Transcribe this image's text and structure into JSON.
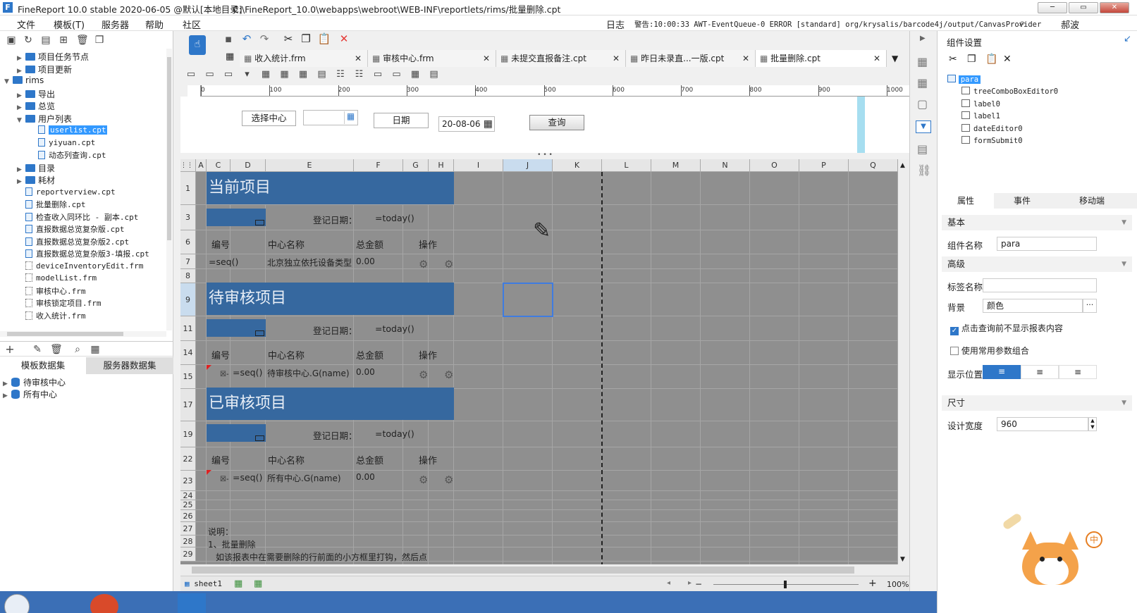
{
  "window": {
    "title": "FineReport 10.0 stable 2020-06-05 @默认[本地目录]",
    "path": "C:\\FineReport_10.0\\webapps\\webroot\\WEB-INF\\reportlets/rims/批量删除.cpt",
    "btn_min": "─",
    "btn_max": "▭",
    "btn_close": "✕"
  },
  "menu": [
    "文件",
    "模板(T)",
    "服务器",
    "帮助",
    "社区"
  ],
  "status": {
    "log": "日志",
    "warning": "警告:10:00:33 AWT-EventQueue-0 ERROR [standard] org/krysalis/barcode4j/output/CanvasProvider",
    "user": "郝波"
  },
  "tree": [
    {
      "label": "项目任务节点",
      "type": "folder",
      "indent": 1,
      "arrow": "▶"
    },
    {
      "label": "项目更新",
      "type": "folder",
      "indent": 1,
      "arrow": "▶"
    },
    {
      "label": "rims",
      "type": "folder",
      "indent": 0,
      "arrow": "▼"
    },
    {
      "label": "导出",
      "type": "folder",
      "indent": 1,
      "arrow": "▶"
    },
    {
      "label": "总览",
      "type": "folder",
      "indent": 1,
      "arrow": "▶"
    },
    {
      "label": "用户列表",
      "type": "folder",
      "indent": 1,
      "arrow": "▼"
    },
    {
      "label": "userlist.cpt",
      "type": "cpt",
      "indent": 2,
      "selected": true
    },
    {
      "label": "yiyuan.cpt",
      "type": "cpt",
      "indent": 2
    },
    {
      "label": "动态列查询.cpt",
      "type": "cpt",
      "indent": 2
    },
    {
      "label": "目录",
      "type": "folder",
      "indent": 1,
      "arrow": "▶"
    },
    {
      "label": "耗材",
      "type": "folder",
      "indent": 1,
      "arrow": "▶"
    },
    {
      "label": "reportverview.cpt",
      "type": "cpt",
      "indent": 1
    },
    {
      "label": "批量删除.cpt",
      "type": "cpt",
      "indent": 1
    },
    {
      "label": "检查收入同环比 - 副本.cpt",
      "type": "cpt",
      "indent": 1
    },
    {
      "label": "直报数据总览复杂版.cpt",
      "type": "cpt",
      "indent": 1
    },
    {
      "label": "直报数据总览复杂版2.cpt",
      "type": "cpt",
      "indent": 1
    },
    {
      "label": "直报数据总览复杂版3-填报.cpt",
      "type": "cpt",
      "indent": 1
    },
    {
      "label": "deviceInventoryEdit.frm",
      "type": "frm",
      "indent": 1
    },
    {
      "label": "modelList.frm",
      "type": "frm",
      "indent": 1
    },
    {
      "label": "审核中心.frm",
      "type": "frm",
      "indent": 1
    },
    {
      "label": "审核锁定项目.frm",
      "type": "frm",
      "indent": 1
    },
    {
      "label": "收入统计.frm",
      "type": "frm",
      "indent": 1
    }
  ],
  "dataset_tabs": [
    "模板数据集",
    "服务器数据集"
  ],
  "datasets": [
    "待审核中心",
    "所有中心"
  ],
  "tabs": [
    "收入统计.frm",
    "审核中心.frm",
    "未提交直报备注.cpt",
    "昨日未录直...一版.cpt",
    "批量删除.cpt"
  ],
  "ruler": [
    "0",
    "100",
    "200",
    "300",
    "400",
    "500",
    "600",
    "700",
    "800",
    "900",
    "1000"
  ],
  "params": {
    "center_label": "选择中心",
    "date_label": "日期",
    "date_value": "20-08-06",
    "query_btn": "查询"
  },
  "columns": [
    "A",
    "C",
    "D",
    "E",
    "F",
    "G",
    "H",
    "I",
    "J",
    "K",
    "L",
    "M",
    "N",
    "O",
    "P",
    "Q"
  ],
  "rows": [
    "1",
    "3",
    "6",
    "7",
    "8",
    "9",
    "11",
    "14",
    "15",
    "17",
    "19",
    "22",
    "23",
    "24",
    "25",
    "26",
    "27",
    "28",
    "29"
  ],
  "sections": [
    {
      "title": "当前项目",
      "reg_label": "登记日期：",
      "reg_value": "=today()",
      "h_no": "编号",
      "h_name": "中心名称",
      "h_amt": "总金额",
      "h_op": "操作",
      "seq": "=seq()",
      "name": "北京独立依托设备类型",
      "amt": "0.00"
    },
    {
      "title": "待审核项目",
      "reg_label": "登记日期：",
      "reg_value": "=today()",
      "h_no": "编号",
      "h_name": "中心名称",
      "h_amt": "总金额",
      "h_op": "操作",
      "seq": "=seq()",
      "name": "待审核中心.G(name)",
      "amt": "0.00"
    },
    {
      "title": "已审核项目",
      "reg_label": "登记日期：",
      "reg_value": "=today()",
      "h_no": "编号",
      "h_name": "中心名称",
      "h_amt": "总金额",
      "h_op": "操作",
      "seq": "=seq()",
      "name": "所有中心.G(name)",
      "amt": "0.00"
    }
  ],
  "notes": [
    "说明：",
    "1、批量删除",
    "如该报表中在需要删除的行前面的小方框里打钩，然后点"
  ],
  "bottom": {
    "sheet": "sheet1",
    "zoom": "100%"
  },
  "right": {
    "header": "组件设置",
    "widgets": [
      "para",
      "treeComboBoxEditor0",
      "label0",
      "label1",
      "dateEditor0",
      "formSubmit0"
    ],
    "tabs": [
      "属性",
      "事件",
      "移动端"
    ],
    "basic": "基本",
    "comp_name_label": "组件名称",
    "comp_name": "para",
    "advanced": "高级",
    "tag_label": "标签名称",
    "bg_label": "背景",
    "bg_value": "颜色",
    "chk1": "点击查询前不显示报表内容",
    "chk2": "使用常用参数组合",
    "pos_label": "显示位置",
    "size": "尺寸",
    "width_label": "设计宽度",
    "width_value": "960"
  },
  "colors": {
    "band": "#36689f",
    "selected": "#3399ff",
    "accent": "#2e77c9"
  }
}
